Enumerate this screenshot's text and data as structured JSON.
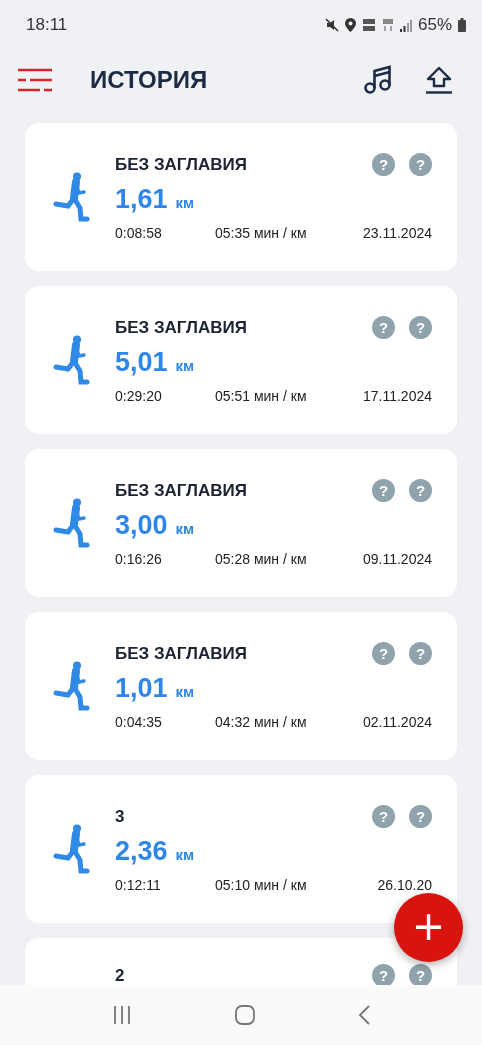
{
  "status_bar": {
    "time": "18:11",
    "battery": "65%"
  },
  "header": {
    "title": "ИСТОРИЯ"
  },
  "runs": [
    {
      "title": "БЕЗ ЗАГЛАВИЯ",
      "distance": "1,61",
      "unit": "км",
      "duration": "0:08:58",
      "pace": "05:35 мин / км",
      "date": "23.11.2024",
      "badges": [
        "?",
        "?"
      ]
    },
    {
      "title": "БЕЗ ЗАГЛАВИЯ",
      "distance": "5,01",
      "unit": "км",
      "duration": "0:29:20",
      "pace": "05:51 мин / км",
      "date": "17.11.2024",
      "badges": [
        "?",
        "?"
      ]
    },
    {
      "title": "БЕЗ ЗАГЛАВИЯ",
      "distance": "3,00",
      "unit": "км",
      "duration": "0:16:26",
      "pace": "05:28 мин / км",
      "date": "09.11.2024",
      "badges": [
        "?",
        "?"
      ]
    },
    {
      "title": "БЕЗ ЗАГЛАВИЯ",
      "distance": "1,01",
      "unit": "км",
      "duration": "0:04:35",
      "pace": "04:32 мин / км",
      "date": "02.11.2024",
      "badges": [
        "?",
        "?"
      ]
    },
    {
      "title": "3",
      "distance": "2,36",
      "unit": "км",
      "duration": "0:12:11",
      "pace": "05:10 мин / км",
      "date": "26.10.20",
      "badges": [
        "?",
        "?"
      ]
    },
    {
      "title": "2",
      "badges": [
        "?",
        "?"
      ]
    }
  ],
  "fab": {
    "label": "+"
  }
}
